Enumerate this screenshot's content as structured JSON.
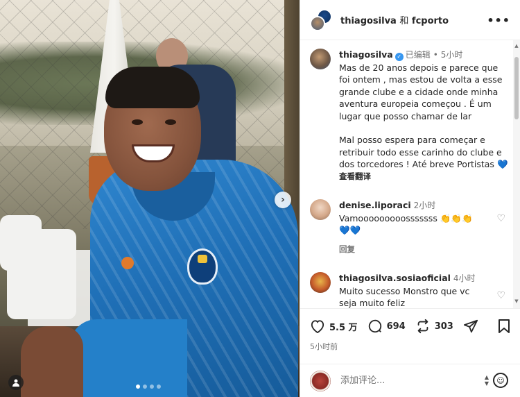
{
  "header": {
    "user1": "thiagosilva",
    "conjunction": "和",
    "user2": "fcporto",
    "more": "•••"
  },
  "caption": {
    "username": "thiagosilva",
    "edited": "已编辑",
    "separator": "•",
    "time": "5小时",
    "paragraph1": "Mas de 20 anos depois e parece que foi ontem , mas estou de volta a esse grande clube e a cidade onde minha aventura europeia começou . É um lugar que posso chamar de lar",
    "paragraph2": "Mal posso espera para começar e retribuir todo esse carinho do clube e dos torcedores ! Até breve Portistas",
    "heart": "💙",
    "translate": "查看翻译"
  },
  "comments": [
    {
      "username": "denise.liporaci",
      "time": "2小时",
      "text": "Vamooooooooosssssss",
      "emojis1": "👏👏👏",
      "emojis2": "💙💙",
      "reply": "回复"
    },
    {
      "username": "thiagosilva.sosiaoficial",
      "time": "4小时",
      "text": "Muito sucesso Monstro que vc seja muito feliz"
    }
  ],
  "actions": {
    "likes": "5.5 万",
    "comments": "694",
    "reposts": "303",
    "posted_ago": "5小时前"
  },
  "comment_box": {
    "placeholder": "添加评论..."
  },
  "carousel": {
    "total": 4,
    "active": 1
  },
  "icons": {
    "next": "chevron-right-icon",
    "like": "heart-outline-icon",
    "comment": "speech-bubble-icon",
    "repost": "repost-icon",
    "share": "paper-plane-icon",
    "save": "bookmark-icon",
    "emoji": "smiley-icon",
    "tagged": "person-icon"
  },
  "colors": {
    "verified": "#3897f0",
    "muted": "#737373",
    "text": "#262626"
  }
}
